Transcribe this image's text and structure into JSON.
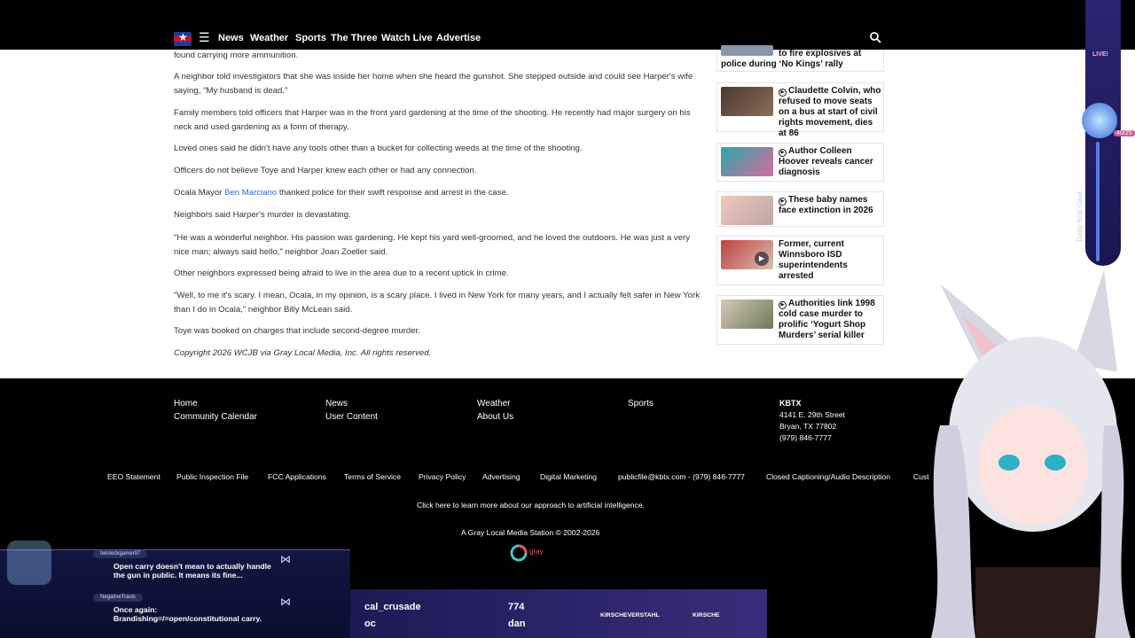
{
  "nav": {
    "links": [
      "News",
      "Weather",
      "Sports",
      "The Three",
      "Watch Live",
      "Advertise"
    ]
  },
  "article": {
    "paragraphs": [
      "found carrying more ammunition.",
      "A neighbor told investigators that she was inside her home when she heard the gunshot. She stepped outside and could see Harper's wife saying, \"My husband is dead.\"",
      "Family members told officers that Harper was in the front yard gardening at the time of the shooting. He recently had major surgery on his neck and used gardening as a form of therapy.",
      "Loved ones said he didn't have any tools other than a bucket for collecting weeds at the time of the shooting.",
      "Officers do not believe Toye and Harper knew each other or had any connection.",
      "Neighbors said Harper's murder is devastating.",
      "\"He was a wonderful neighbor. His passion was gardening. He kept his yard well-groomed, and he loved the outdoors. He was just a very nice man; always said hello,\" neighbor Joan Zoeller said.",
      "Other neighbors expressed being afraid to live in the area due to a recent uptick in crime.",
      "\"Well, to me it's scary. I mean, Ocala, in my opinion, is a scary place. I lived in New York for many years, and I actually felt safer in New York than I do in Ocala,\" neighbor Billy McLean said.",
      "Toye was booked on charges that include second-degree murder.",
      "Copyright 2026 WCJB via Gray Local Media, Inc. All rights reserved."
    ],
    "mayor_prefix": "Ocala Mayor ",
    "mayor_link": "Ben Marciano",
    "mayor_suffix": " thanked police for their swift response and arrest in the case."
  },
  "sidebar": {
    "items": [
      "to fire explosives at police during ‘No Kings’ rally",
      "Claudette Colvin, who refused to move seats on a bus at start of civil rights movement, dies at 86",
      "Author Colleen Hoover reveals cancer diagnosis",
      "These baby names face extinction in 2026",
      "Former, current Winnsboro ISD superintendents arrested",
      "Authorities link 1998 cold case murder to prolific ‘Yogurt Shop Murders’ serial killer"
    ]
  },
  "footer": {
    "col1": [
      "Home",
      "Community Calendar"
    ],
    "col2": [
      "News",
      "User Content"
    ],
    "col3": [
      "Weather",
      "About Us"
    ],
    "col4": [
      "Sports"
    ],
    "station": "KBTX",
    "address1": "4141 E. 29th Street",
    "address2": "Bryan, TX 77802",
    "phone": "(979) 846-7777",
    "legal_links": [
      "EEO Statement",
      "Public Inspection File",
      "FCC Applications",
      "Terms of Service",
      "Privacy Policy",
      "Advertising",
      "Digital Marketing",
      "publicfile@kbtx.com - (979) 846-7777",
      "Closed Captioning/Audio Description",
      "Cust"
    ],
    "ai_note": "Click here to learn more about our approach to artificial intelligence.",
    "station_line": "A Gray Local Media Station © 2002-2026",
    "gray_logo": "gray"
  },
  "overlay": {
    "live_label": "LIVE!",
    "goal_label": "Daily Sub Goal",
    "goal_count": "40/25",
    "chat": [
      {
        "user": "twistedxgamer97",
        "message": "Open carry doesn't mean to actually handle the gun in public. It means its fine..."
      },
      {
        "user": "NegativeTravis",
        "message": "Once again: Brandishing=/=open/constitutional carry."
      }
    ],
    "bar": {
      "name1": "cal_crusade",
      "value1": "774",
      "name2": "oc",
      "value2": "dan",
      "tag1": "KIRSCHEVERSTAHL",
      "tag2": "KIRSCHE"
    }
  },
  "colors": {
    "link_blue": "#2d6ad8",
    "footer_bg": "#000000",
    "overlay_purple": "#3a2d7a"
  }
}
